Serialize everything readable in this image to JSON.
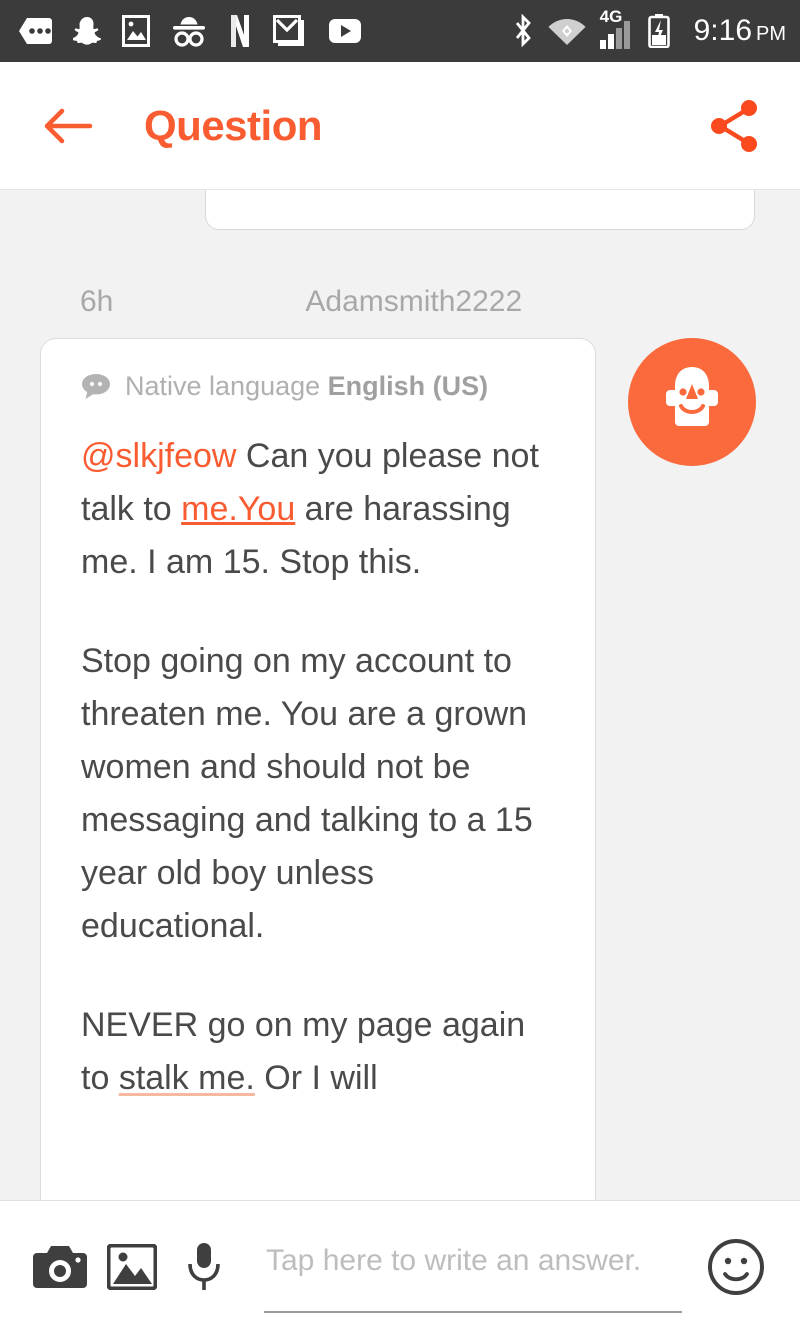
{
  "status_bar": {
    "background": "#3b3b3b",
    "time": "9:16",
    "ampm": "PM",
    "notification_icons": [
      "messages-icon",
      "snapchat-icon",
      "photo-icon",
      "incognito-icon",
      "netflix-icon",
      "gmail-icon",
      "youtube-icon"
    ],
    "system_icons": [
      "bluetooth-icon",
      "wifi-vpn-icon",
      "mobile-signal-4g-icon",
      "battery-charging-icon"
    ],
    "network_label": "4G"
  },
  "header": {
    "title": "Question",
    "accent_color": "#FA5C31",
    "back_icon": "back-arrow-icon",
    "share_icon": "share-icon"
  },
  "thread": {
    "meta": {
      "timestamp": "6h",
      "username": "Adamsmith2222"
    },
    "answer": {
      "language_icon": "speech-bubble-icon",
      "language_label": "Native language",
      "language_value": "English (US)",
      "mention": "@slkjfeow",
      "paragraph_1_before_link": " Can you please not talk to ",
      "paragraph_1_link": "me.You",
      "paragraph_1_after_link": " are harassing me. I am 15. Stop this.",
      "paragraph_2": "Stop going on my account to threaten me. You are a grown women and should not be messaging and talking to a 15 year old boy unless educational.",
      "paragraph_3_part1": "NEVER go on my page again to ",
      "paragraph_3_link": "stalk me.",
      "paragraph_3_part2": " Or I will"
    },
    "avatar_icon": "default-user-avatar-icon"
  },
  "input_bar": {
    "camera_icon": "camera-icon",
    "gallery_icon": "gallery-icon",
    "microphone_icon": "microphone-icon",
    "emoji_icon": "emoji-smiley-icon",
    "placeholder": "Tap here to write an answer.",
    "value": ""
  }
}
